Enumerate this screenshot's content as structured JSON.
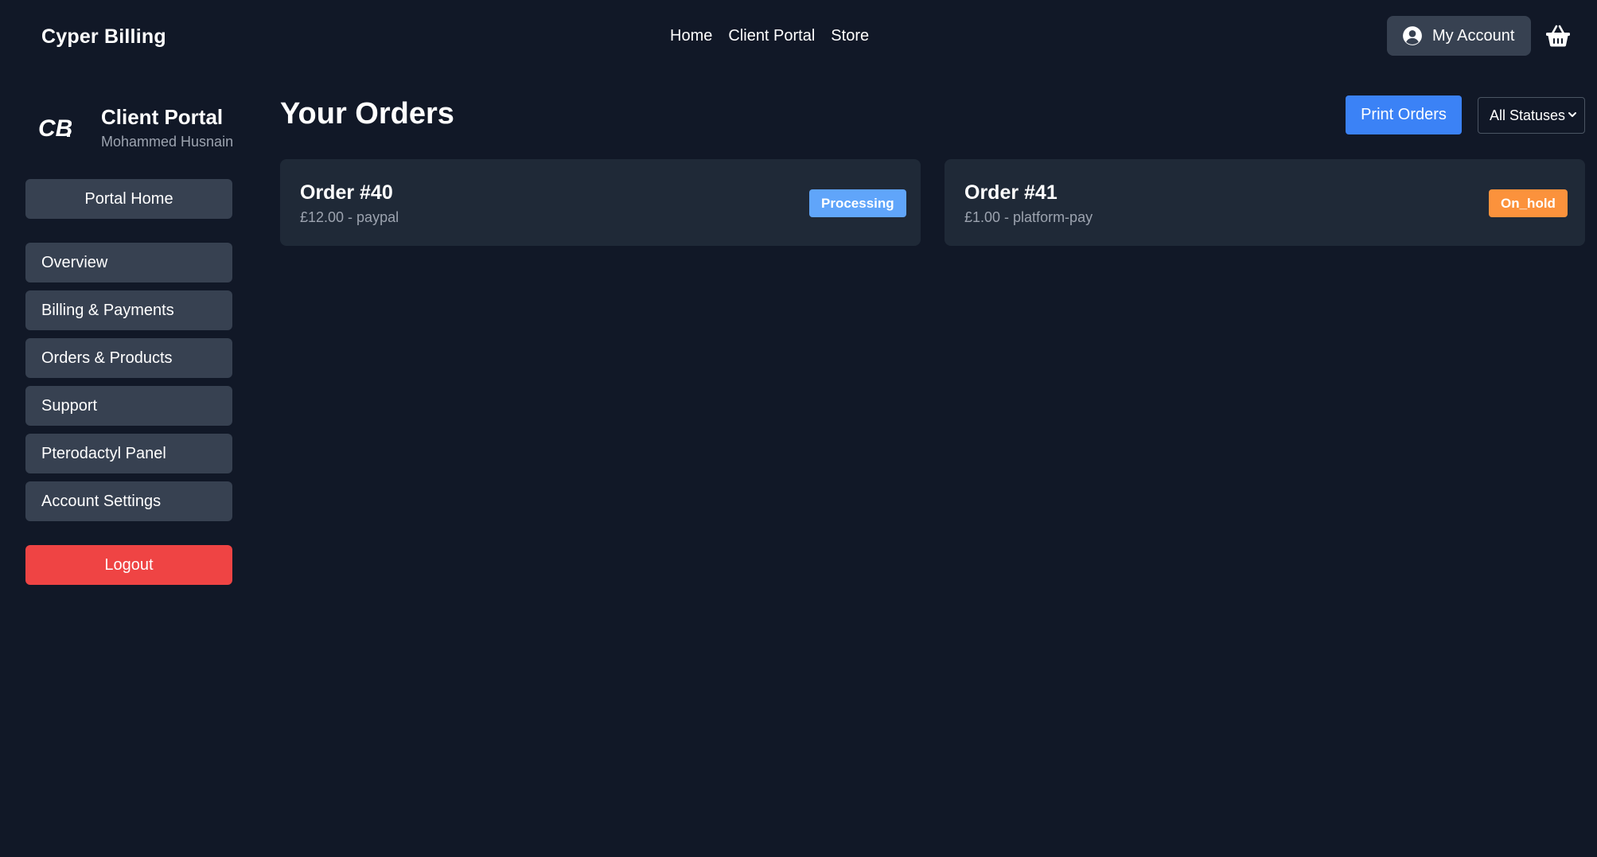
{
  "header": {
    "brand": "Cyper Billing",
    "nav": [
      "Home",
      "Client Portal",
      "Store"
    ],
    "account_label": "My Account"
  },
  "sidebar": {
    "title": "Client Portal",
    "user_name": "Mohammed Husnain",
    "portal_home_label": "Portal Home",
    "items": [
      {
        "label": "Overview"
      },
      {
        "label": "Billing & Payments"
      },
      {
        "label": "Orders & Products"
      },
      {
        "label": "Support"
      },
      {
        "label": "Pterodactyl Panel"
      },
      {
        "label": "Account Settings"
      }
    ],
    "logout_label": "Logout"
  },
  "main": {
    "title": "Your Orders",
    "print_label": "Print Orders",
    "status_filter": {
      "selected": "All Statuses"
    },
    "orders": [
      {
        "title": "Order #40",
        "meta": "£12.00 - paypal",
        "status": "Processing",
        "status_color": "#60a5fa"
      },
      {
        "title": "Order #41",
        "meta": "£1.00 - platform-pay",
        "status": "On_hold",
        "status_color": "#fb923c"
      }
    ]
  },
  "colors": {
    "background": "#111827",
    "card": "#1f2937",
    "button": "#374151",
    "primary": "#3b82f6",
    "danger": "#ef4444"
  }
}
